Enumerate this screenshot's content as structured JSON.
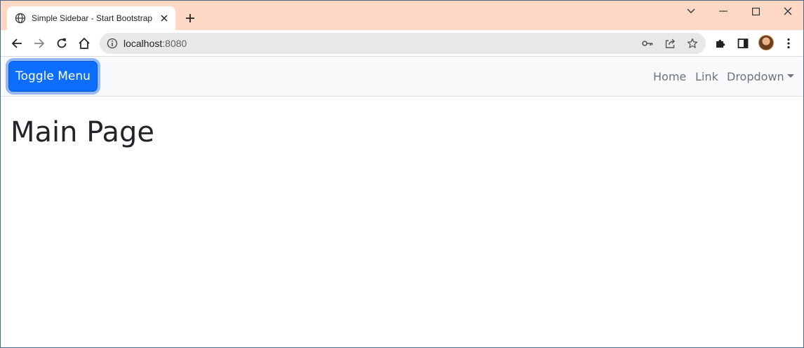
{
  "browser": {
    "tab": {
      "title": "Simple Sidebar - Start Bootstrap",
      "icon": "globe-icon"
    },
    "address": {
      "host": "localhost",
      "port": ":8080"
    }
  },
  "navbar": {
    "toggle_label": "Toggle Menu",
    "links": [
      "Home",
      "Link",
      "Dropdown"
    ]
  },
  "main": {
    "title": "Main Page"
  },
  "colors": {
    "tab_strip": "#fdd9c5",
    "primary": "#0d6efd",
    "navbar_bg": "#f8f9fa"
  }
}
